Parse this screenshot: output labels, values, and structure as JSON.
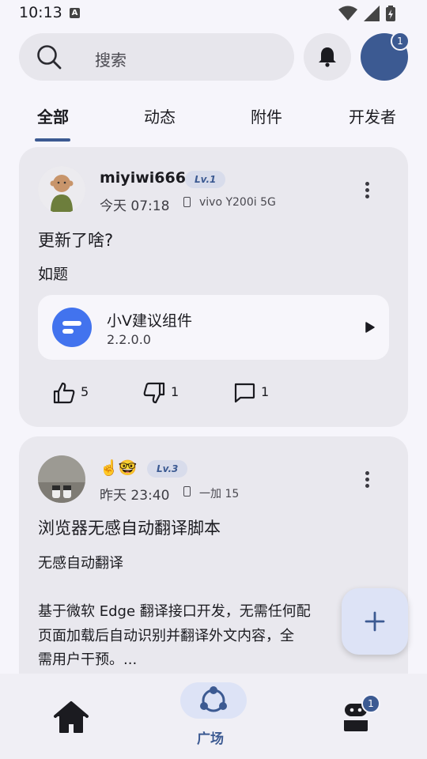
{
  "status_bar": {
    "time": "10:13",
    "notification_letter": "A"
  },
  "search": {
    "placeholder": "搜索"
  },
  "header": {
    "avatar_badge": "1"
  },
  "tabs": [
    {
      "label": "全部",
      "active": true
    },
    {
      "label": "动态",
      "active": false
    },
    {
      "label": "附件",
      "active": false
    },
    {
      "label": "开发者",
      "active": false
    }
  ],
  "posts": [
    {
      "username": "miyiwi666",
      "level": "Lv.1",
      "time": "今天 07:18",
      "device": "vivo Y200i 5G",
      "title": "更新了啥?",
      "body": "如题",
      "plugin": {
        "name": "小V建议组件",
        "version": "2.2.0.0"
      },
      "likes": "5",
      "dislikes": "1",
      "comments": "1"
    },
    {
      "username": "☝️🤓",
      "level": "Lv.3",
      "time": "昨天 23:40",
      "device": "一加 15",
      "title": "浏览器无感自动翻译脚本",
      "body_lines": [
        "无感自动翻译",
        "",
        "基于微软 Edge 翻译接口开发，无需任何配",
        "页面加载后自动识别并翻译外文内容，全",
        "需用户干预。..."
      ]
    }
  ],
  "bottom_nav": {
    "square_label": "广场",
    "profile_badge": "1"
  },
  "colors": {
    "accent": "#3c5a92",
    "card": "#e9e8ee",
    "background": "#f6f5fb",
    "plugin_icon": "#4273ee"
  }
}
